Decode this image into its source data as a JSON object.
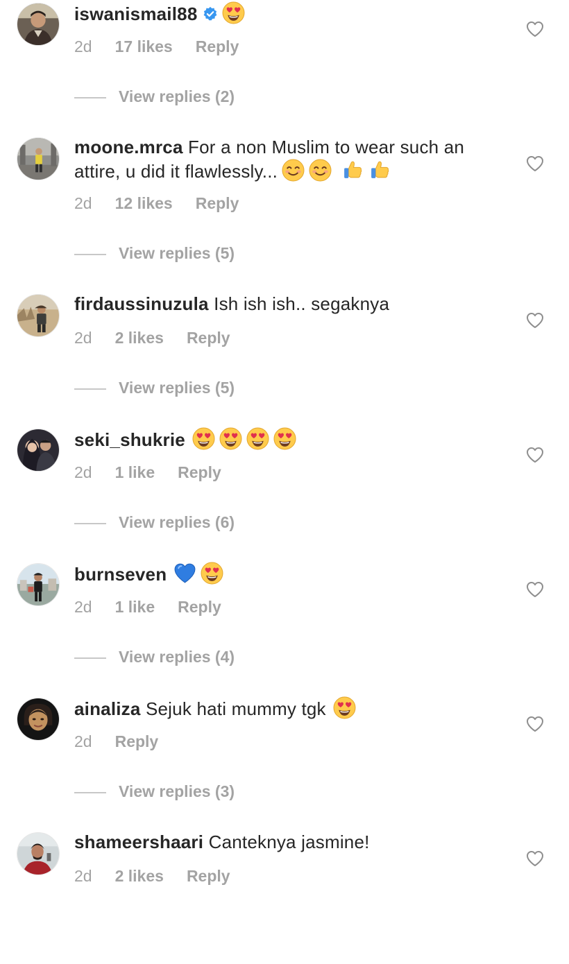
{
  "colors": {
    "text": "#262626",
    "muted": "#a3a3a3",
    "verified": "#3897f0",
    "heart_outline": "#8e8e8e"
  },
  "comments": [
    {
      "username": "iswanismail88",
      "verified": true,
      "text": "",
      "emojis": [
        "heart-eyes"
      ],
      "time": "2d",
      "likes": "17 likes",
      "reply_label": "Reply",
      "view_replies": "View replies (2)"
    },
    {
      "username": "moone.mrca",
      "verified": false,
      "text": "For a non Muslim to wear such an attire, u did it flawlessly...",
      "emojis": [
        "smiling",
        "smiling",
        "thumbs-up",
        "thumbs-up"
      ],
      "time": "2d",
      "likes": "12 likes",
      "reply_label": "Reply",
      "view_replies": "View replies (5)"
    },
    {
      "username": "firdaussinuzula",
      "verified": false,
      "text": "Ish ish ish.. segaknya",
      "emojis": [],
      "time": "2d",
      "likes": "2 likes",
      "reply_label": "Reply",
      "view_replies": "View replies (5)"
    },
    {
      "username": "seki_shukrie",
      "verified": false,
      "text": "",
      "emojis": [
        "heart-eyes",
        "heart-eyes",
        "heart-eyes",
        "heart-eyes"
      ],
      "time": "2d",
      "likes": "1 like",
      "reply_label": "Reply",
      "view_replies": "View replies (6)"
    },
    {
      "username": "burnseven",
      "verified": false,
      "text": "",
      "emojis": [
        "blue-heart",
        "heart-eyes"
      ],
      "time": "2d",
      "likes": "1 like",
      "reply_label": "Reply",
      "view_replies": "View replies (4)"
    },
    {
      "username": "ainaliza",
      "verified": false,
      "text": "Sejuk hati mummy tgk",
      "emojis": [
        "heart-eyes"
      ],
      "time": "2d",
      "likes": "",
      "reply_label": "Reply",
      "view_replies": "View replies (3)"
    },
    {
      "username": "shameershaari",
      "verified": false,
      "text": "Canteknya jasmine!",
      "emojis": [],
      "time": "2d",
      "likes": "2 likes",
      "reply_label": "Reply",
      "view_replies": ""
    }
  ]
}
